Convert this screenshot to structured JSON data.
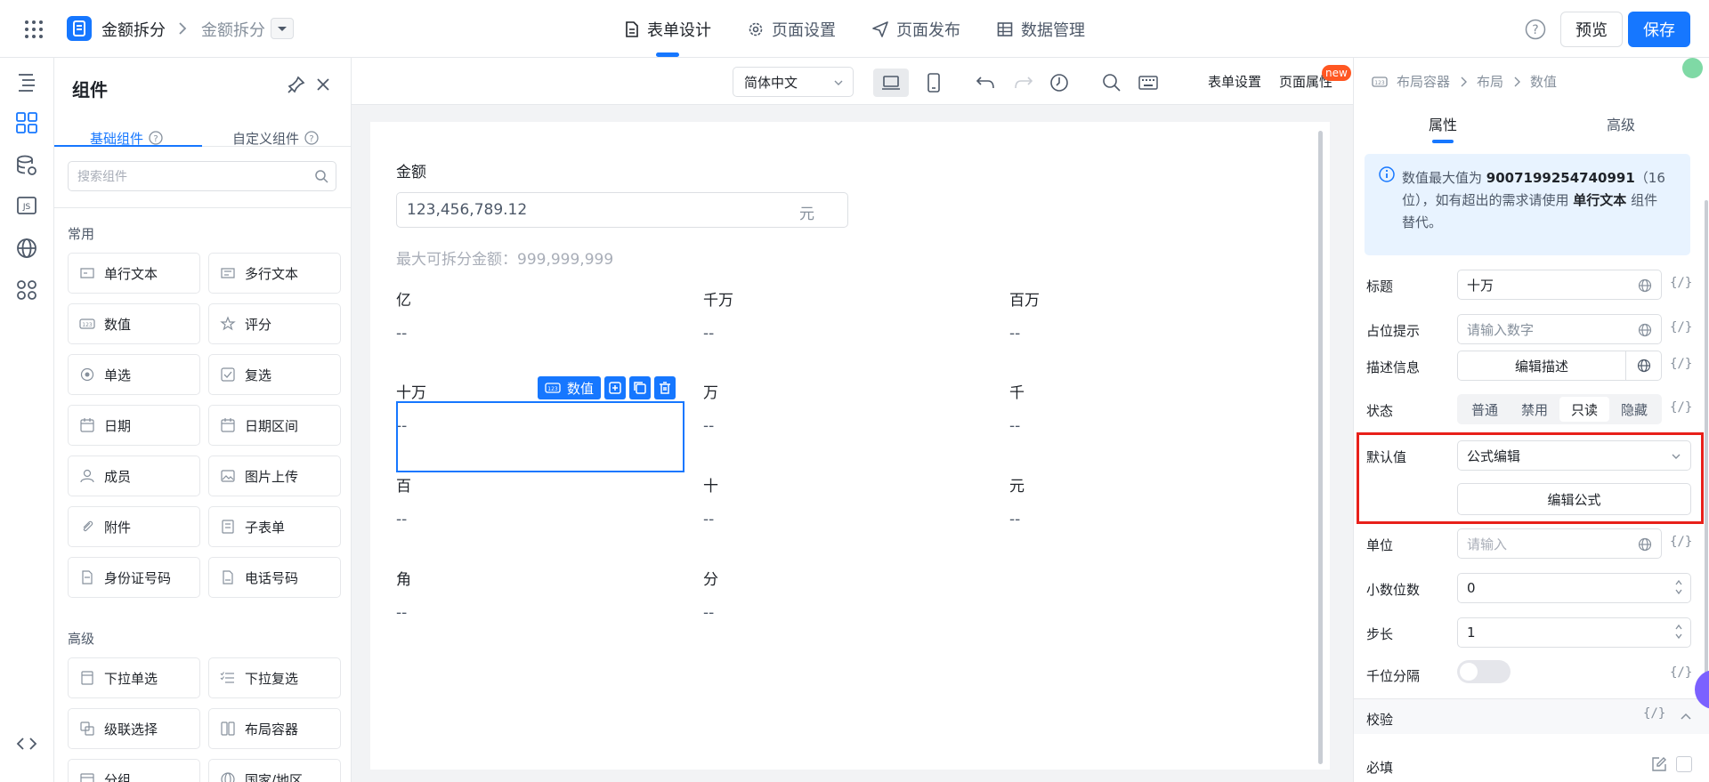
{
  "header": {
    "app_name": "金额拆分",
    "page_name": "金额拆分",
    "nav_tabs": [
      "表单设计",
      "页面设置",
      "页面发布",
      "数据管理"
    ],
    "active_tab": "表单设计",
    "preview_label": "预览",
    "save_label": "保存"
  },
  "component_panel": {
    "title": "组件",
    "tabs": [
      "基础组件",
      "自定义组件"
    ],
    "search_placeholder": "搜索组件",
    "sections": [
      {
        "title": "常用",
        "items": [
          "单行文本",
          "多行文本",
          "数值",
          "评分",
          "单选",
          "复选",
          "日期",
          "日期区间",
          "成员",
          "图片上传",
          "附件",
          "子表单",
          "身份证号码",
          "电话号码"
        ]
      },
      {
        "title": "高级",
        "items": [
          "下拉单选",
          "下拉复选",
          "级联选择",
          "布局容器",
          "分组",
          "国家/地区"
        ]
      }
    ]
  },
  "toolbar": {
    "language": "简体中文",
    "form_settings": "表单设置",
    "page_props": "页面属性",
    "new_badge": "new"
  },
  "form": {
    "amount_label": "金额",
    "amount_value": "123,456,789.12",
    "amount_unit": "元",
    "amount_desc": "最大可拆分金额：999,999,999",
    "digit_fields": [
      {
        "label": "亿",
        "value": "--"
      },
      {
        "label": "千万",
        "value": "--"
      },
      {
        "label": "百万",
        "value": "--"
      },
      {
        "label": "十万",
        "value": "--"
      },
      {
        "label": "万",
        "value": "--"
      },
      {
        "label": "千",
        "value": "--"
      },
      {
        "label": "百",
        "value": "--"
      },
      {
        "label": "十",
        "value": "--"
      },
      {
        "label": "元",
        "value": "--"
      },
      {
        "label": "角",
        "value": "--"
      },
      {
        "label": "分",
        "value": "--"
      }
    ],
    "selected_tag": "数值"
  },
  "properties": {
    "breadcrumb": [
      "布局容器",
      "布局",
      "数值"
    ],
    "tabs": [
      "属性",
      "高级"
    ],
    "info": {
      "prefix": "数值最大值为",
      "max_value": "9007199254740991",
      "middle": "（16位），如有超出的需求请使用",
      "component": "单行文本",
      "suffix": "组件替代。"
    },
    "title_label": "标题",
    "title_value": "十万",
    "placeholder_label": "占位提示",
    "placeholder_value": "请输入数字",
    "desc_label": "描述信息",
    "desc_button": "编辑描述",
    "state_label": "状态",
    "state_options": [
      "普通",
      "禁用",
      "只读",
      "隐藏"
    ],
    "state_active": "只读",
    "default_label": "默认值",
    "default_mode": "公式编辑",
    "edit_formula": "编辑公式",
    "unit_label": "单位",
    "unit_placeholder": "请输入",
    "decimals_label": "小数位数",
    "decimals_value": "0",
    "step_label": "步长",
    "step_value": "1",
    "thousands_label": "千位分隔",
    "thousands_on": false,
    "validation_title": "校验",
    "required_label": "必填",
    "fx_label": "{/}"
  },
  "colors": {
    "accent": "#1677ff",
    "highlight": "#e8201a",
    "info_bg": "#e8f3ff"
  }
}
